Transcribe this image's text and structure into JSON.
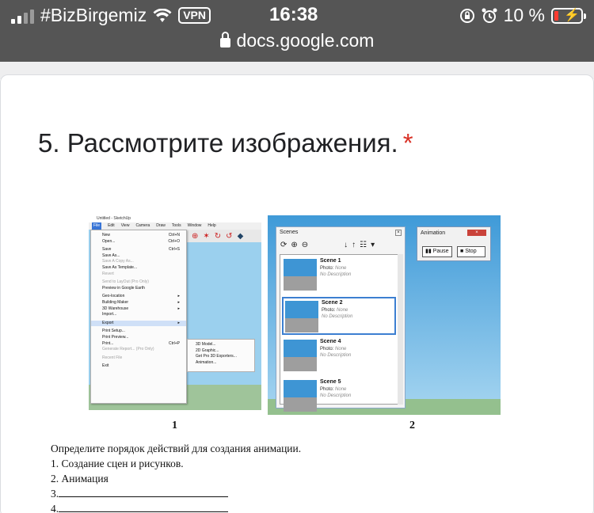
{
  "status_bar": {
    "carrier": "#BizBirgemiz",
    "vpn": "VPN",
    "time": "16:38",
    "battery_percent": "10 %",
    "battery_level": 0.1
  },
  "browser": {
    "url": "docs.google.com"
  },
  "question": {
    "title": "5. Рассмотрите изображения.",
    "required_mark": "*"
  },
  "figure1": {
    "window_title": "Untitled - SketchUp",
    "menu": [
      "File",
      "Edit",
      "View",
      "Camera",
      "Draw",
      "Tools",
      "Window",
      "Help"
    ],
    "file_menu": [
      {
        "label": "New",
        "shortcut": "Ctrl+N",
        "disabled": false
      },
      {
        "label": "Open...",
        "shortcut": "Ctrl+O",
        "disabled": false
      },
      {
        "label": "Save",
        "shortcut": "Ctrl+S",
        "disabled": false
      },
      {
        "label": "Save As...",
        "shortcut": "",
        "disabled": false
      },
      {
        "label": "Save A Copy As...",
        "shortcut": "",
        "disabled": true
      },
      {
        "label": "Save As Template...",
        "shortcut": "",
        "disabled": false
      },
      {
        "label": "Revert",
        "shortcut": "",
        "disabled": true
      },
      {
        "label": "Send to LayOut (Pro Only)",
        "shortcut": "",
        "disabled": true
      },
      {
        "label": "Preview in Google Earth",
        "shortcut": "",
        "disabled": false
      },
      {
        "label": "Geo-location",
        "shortcut": "▸",
        "disabled": false
      },
      {
        "label": "Building Maker",
        "shortcut": "▸",
        "disabled": false
      },
      {
        "label": "3D Warehouse",
        "shortcut": "▸",
        "disabled": false
      },
      {
        "label": "Import...",
        "shortcut": "",
        "disabled": false
      },
      {
        "label": "Export",
        "shortcut": "▸",
        "disabled": false
      },
      {
        "label": "Print Setup...",
        "shortcut": "",
        "disabled": false
      },
      {
        "label": "Print Preview...",
        "shortcut": "",
        "disabled": false
      },
      {
        "label": "Print...",
        "shortcut": "Ctrl+P",
        "disabled": false
      },
      {
        "label": "Generate Report... (Pro Only)",
        "shortcut": "",
        "disabled": true
      },
      {
        "label": "Recent File",
        "shortcut": "",
        "disabled": true
      },
      {
        "label": "Exit",
        "shortcut": "",
        "disabled": false
      }
    ],
    "export_submenu": [
      "3D Model...",
      "2D Graphic...",
      "Get Pro 3D Exporters...",
      "Animation..."
    ],
    "caption": "1"
  },
  "figure2": {
    "scenes_panel_title": "Scenes",
    "scenes": [
      {
        "name": "Scene 1",
        "photo_label": "Photo:",
        "photo_value": "None",
        "description": "No Description",
        "selected": false
      },
      {
        "name": "Scene 2",
        "photo_label": "Photo:",
        "photo_value": "None",
        "description": "No Description",
        "selected": true
      },
      {
        "name": "Scene 4",
        "photo_label": "Photo:",
        "photo_value": "None",
        "description": "No Description",
        "selected": false
      },
      {
        "name": "Scene 5",
        "photo_label": "Photo:",
        "photo_value": "None",
        "description": "No Description",
        "selected": false
      }
    ],
    "animation_title": "Animation",
    "pause_label": "Pause",
    "stop_label": "Stop",
    "caption": "2"
  },
  "task": {
    "prompt": "Определите порядок действий для создания анимации.",
    "step1": "1. Создание сцен и рисунков.",
    "step2": "2. Анимация",
    "step3_label": "3.",
    "step4_label": "4."
  }
}
